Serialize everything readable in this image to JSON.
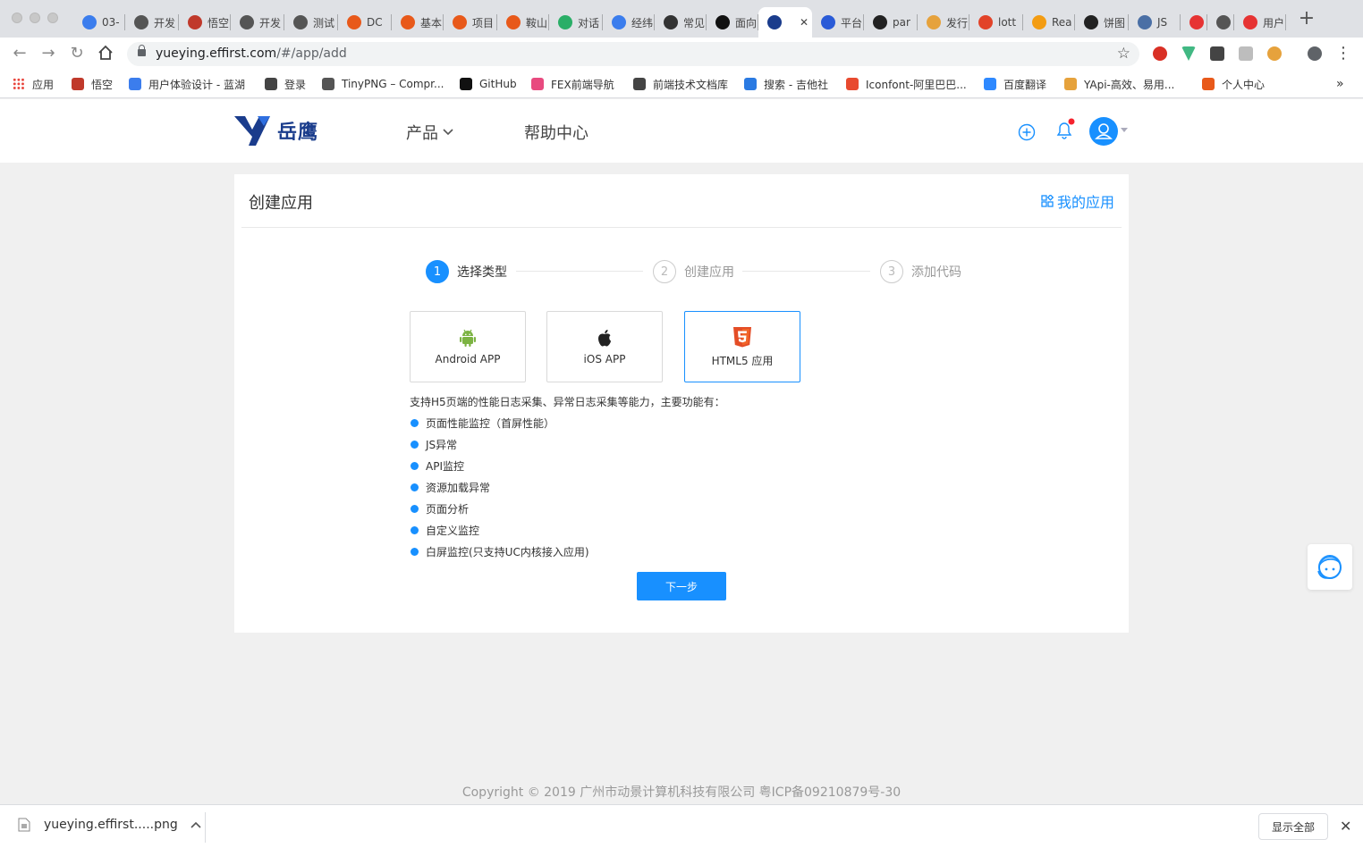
{
  "browser": {
    "tabs": [
      {
        "label": "03-",
        "icon": "bear-icon",
        "color": "#3b7ded"
      },
      {
        "label": "开发",
        "icon": "globe-icon",
        "color": "#555555"
      },
      {
        "label": "悟空",
        "icon": "monkey-icon",
        "color": "#c0392b"
      },
      {
        "label": "开发",
        "icon": "globe-icon",
        "color": "#555555"
      },
      {
        "label": "测试",
        "icon": "globe-icon",
        "color": "#555555"
      },
      {
        "label": "DC",
        "icon": "mi-icon",
        "color": "#e8591a"
      },
      {
        "label": "基本",
        "icon": "mi-icon",
        "color": "#e8591a"
      },
      {
        "label": "项目",
        "icon": "mi-icon",
        "color": "#e8591a"
      },
      {
        "label": "鞍山",
        "icon": "mi-icon",
        "color": "#e8591a"
      },
      {
        "label": "对话",
        "icon": "wechat-icon",
        "color": "#2aae67"
      },
      {
        "label": "经纬",
        "icon": "bear-icon",
        "color": "#3b7ded"
      },
      {
        "label": "常见",
        "icon": "chart-icon",
        "color": "#333333"
      },
      {
        "label": "面向",
        "icon": "circle-icon",
        "color": "#111111"
      },
      {
        "label": "",
        "icon": "yueying-icon",
        "color": "#1a3c8c",
        "active": true
      },
      {
        "label": "平台",
        "icon": "feather-icon",
        "color": "#2a5bd7"
      },
      {
        "label": "par",
        "icon": "codepen-icon",
        "color": "#222222"
      },
      {
        "label": "发行",
        "icon": "yapi-icon",
        "color": "#e6a23c"
      },
      {
        "label": "lott",
        "icon": "gitlab-icon",
        "color": "#e24329"
      },
      {
        "label": "Rea",
        "icon": "react-icon",
        "color": "#f39c12"
      },
      {
        "label": "饼图",
        "icon": "codepen-icon",
        "color": "#222222"
      },
      {
        "label": "JS",
        "icon": "js-icon",
        "color": "#4a6fa5"
      },
      {
        "label": "",
        "icon": "ting-icon",
        "color": "#e63333"
      },
      {
        "label": "",
        "icon": "speaker-icon",
        "color": "#555555"
      },
      {
        "label": "用户",
        "icon": "h5-icon",
        "color": "#e63333"
      }
    ],
    "url_host": "yueying.effirst.com",
    "url_path": "/#/app/add",
    "bookmarks": [
      {
        "label": "应用",
        "color": "#4285f4"
      },
      {
        "label": "悟空",
        "color": "#c0392b"
      },
      {
        "label": "用户体验设计 - 蓝湖",
        "color": "#3b7ded"
      },
      {
        "label": "登录",
        "color": "#444444"
      },
      {
        "label": "TinyPNG – Compr...",
        "color": "#555555"
      },
      {
        "label": "GitHub",
        "color": "#111111"
      },
      {
        "label": "FEX前端导航",
        "color": "#e84a7f"
      },
      {
        "label": "前端技术文档库",
        "color": "#444444"
      },
      {
        "label": "搜索 - 吉他社",
        "color": "#2a7ae2"
      },
      {
        "label": "Iconfont-阿里巴巴...",
        "color": "#e84a2f"
      },
      {
        "label": "百度翻译",
        "color": "#2e89ff"
      },
      {
        "label": "YApi-高效、易用...",
        "color": "#e6a23c"
      },
      {
        "label": "个人中心",
        "color": "#e8591a"
      }
    ],
    "bookmark_overflow": "»"
  },
  "site": {
    "logo_text": "岳鹰",
    "nav": {
      "products": "产品",
      "help": "帮助中心"
    }
  },
  "page": {
    "title": "创建应用",
    "my_apps": "我的应用",
    "steps": [
      {
        "num": "1",
        "label": "选择类型"
      },
      {
        "num": "2",
        "label": "创建应用"
      },
      {
        "num": "3",
        "label": "添加代码"
      }
    ],
    "types": [
      {
        "label": "Android APP"
      },
      {
        "label": "iOS APP"
      },
      {
        "label": "HTML5 应用"
      }
    ],
    "description": "支持H5页端的性能日志采集、异常日志采集等能力，主要功能有：",
    "features": [
      "页面性能监控（首屏性能）",
      "JS异常",
      "API监控",
      "资源加载异常",
      "页面分析",
      "自定义监控",
      "白屏监控(只支持UC内核接入应用)"
    ],
    "next_button": "下一步"
  },
  "footer": {
    "copyright": "Copyright © 2019 广州市动景计算机科技有限公司 粤ICP备09210879号-30"
  },
  "download_bar": {
    "filename": "yueying.effirst.....png",
    "show_all": "显示全部"
  },
  "colors": {
    "primary": "#1890ff",
    "background": "#f0f0f0",
    "brand": "#1a3c8c",
    "android": "#7cb342",
    "html5": "#e44d26"
  }
}
